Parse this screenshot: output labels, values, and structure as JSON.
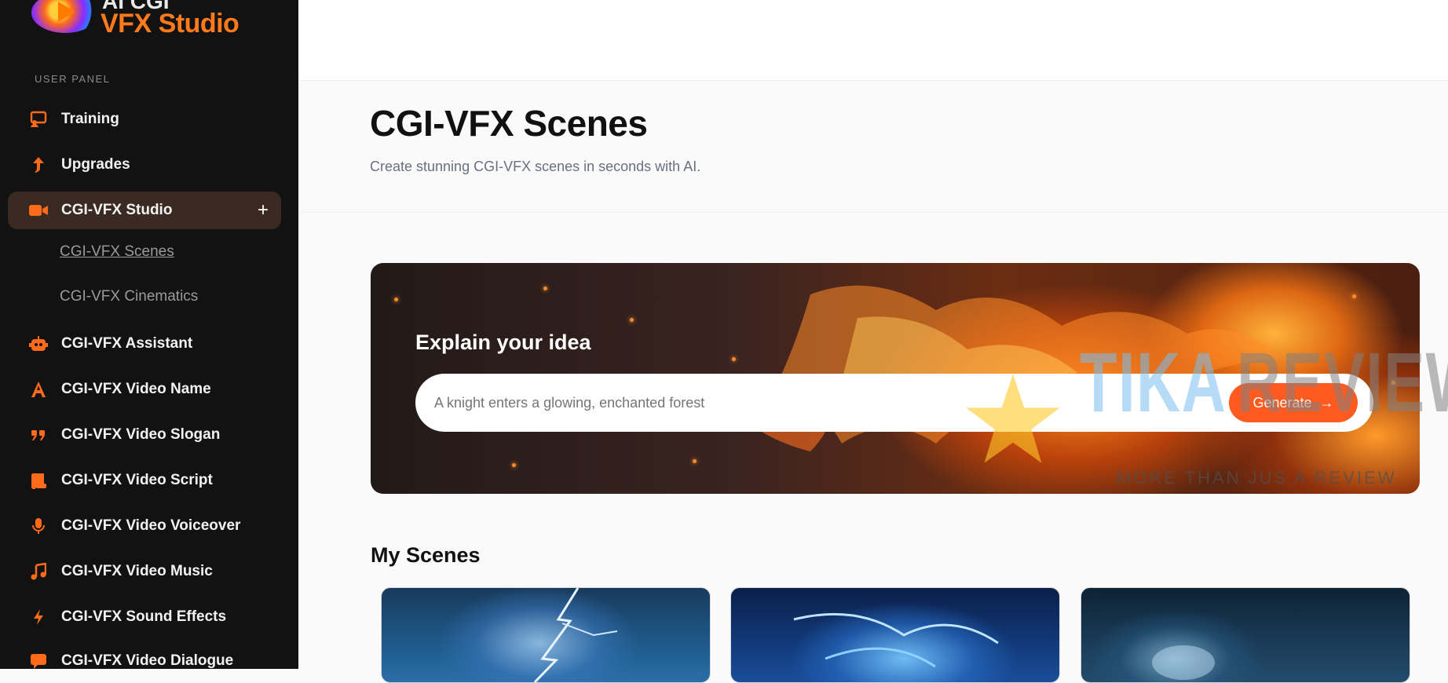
{
  "app": {
    "logo_top": "AI CGI",
    "logo_bottom": "VFX Studio"
  },
  "sidebar": {
    "panel_label": "USER PANEL",
    "items": [
      {
        "label": "Training",
        "icon": "presentation-icon"
      },
      {
        "label": "Upgrades",
        "icon": "arrow-up-icon"
      },
      {
        "label": "CGI-VFX Studio",
        "icon": "video-camera-icon",
        "active": true
      },
      {
        "label": "CGI-VFX Assistant",
        "icon": "robot-icon"
      },
      {
        "label": "CGI-VFX Video Name",
        "icon": "letter-a-icon"
      },
      {
        "label": "CGI-VFX Video Slogan",
        "icon": "quote-icon"
      },
      {
        "label": "CGI-VFX Video Script",
        "icon": "script-icon"
      },
      {
        "label": "CGI-VFX Video Voiceover",
        "icon": "microphone-icon"
      },
      {
        "label": "CGI-VFX Video Music",
        "icon": "music-note-icon"
      },
      {
        "label": "CGI-VFX Sound Effects",
        "icon": "lightning-icon"
      },
      {
        "label": "CGI-VFX Video Dialogue",
        "icon": "chat-icon"
      }
    ],
    "sub_items": [
      {
        "label": "CGI-VFX Scenes",
        "current": true
      },
      {
        "label": "CGI-VFX Cinematics",
        "current": false
      }
    ],
    "expand_symbol": "+"
  },
  "main": {
    "title": "CGI-VFX Scenes",
    "subtitle": "Create stunning CGI-VFX scenes in seconds with AI.",
    "hero": {
      "heading": "Explain your idea",
      "input_placeholder": "A knight enters a glowing, enchanted forest",
      "generate_label": "Generate",
      "generate_arrow": "→"
    },
    "my_scenes_title": "My Scenes"
  },
  "watermark": {
    "brand_a": "TIKA",
    "brand_b": "REVIEW",
    "tagline": "MORE THAN JUS A REVIEW"
  },
  "colors": {
    "accent": "#ff5a1f",
    "sidebar_bg": "#121212",
    "active_bg": "#3b2a22"
  }
}
